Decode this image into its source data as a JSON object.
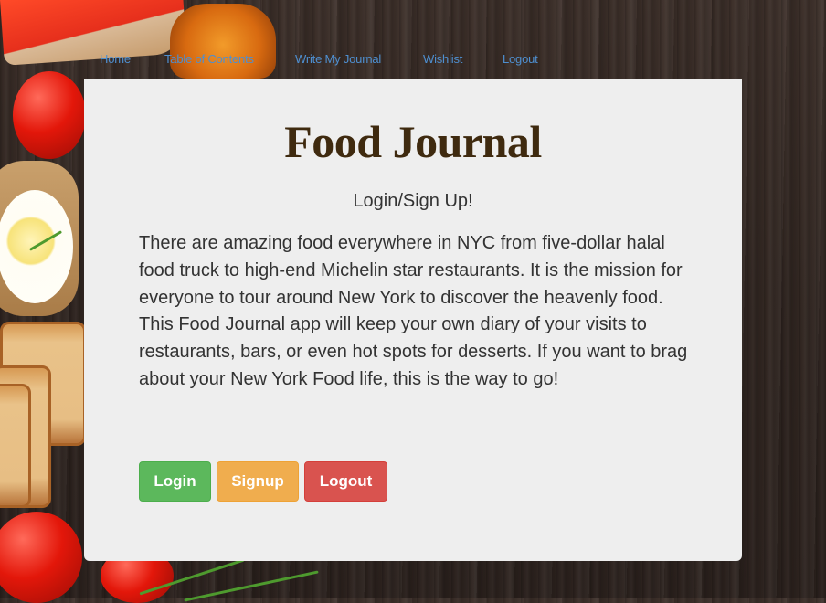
{
  "nav": {
    "items": [
      "Home",
      "Table of Contents",
      "Write My Journal",
      "Wishlist",
      "Logout"
    ]
  },
  "card": {
    "title": "Food Journal",
    "subtitle": "Login/Sign Up!",
    "description": "There are amazing food everywhere in NYC from five-dollar halal food truck to high-end Michelin star restaurants. It is the mission for everyone to tour around New York to discover the heavenly food. This Food Journal app will keep your own diary of your visits to restaurants, bars, or even hot spots for desserts. If you want to brag about your New York Food life, this is the way to go!",
    "buttons": {
      "login": "Login",
      "signup": "Signup",
      "logout": "Logout"
    }
  },
  "colors": {
    "link": "#4e8fd0",
    "title": "#3f2a0f",
    "login_button": "#5cb85c",
    "signup_button": "#f0ad4e",
    "logout_button": "#d9534f",
    "card_background": "#eeeeee"
  }
}
